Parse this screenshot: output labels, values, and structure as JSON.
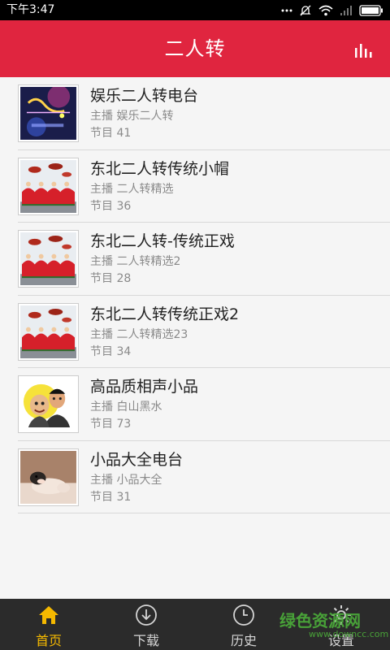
{
  "status_bar": {
    "time": "下午3:47"
  },
  "app_bar": {
    "title": "二人转"
  },
  "stations": [
    {
      "title": "娱乐二人转电台",
      "host": "主播 娱乐二人转",
      "count": "节目 41"
    },
    {
      "title": "东北二人转传统小帽",
      "host": "主播 二人转精选",
      "count": "节目 36"
    },
    {
      "title": "东北二人转-传统正戏",
      "host": "主播 二人转精选2",
      "count": "节目 28"
    },
    {
      "title": "东北二人转传统正戏2",
      "host": "主播 二人转精选23",
      "count": "节目 34"
    },
    {
      "title": "高品质相声小品",
      "host": "主播 白山黑水",
      "count": "节目 73"
    },
    {
      "title": "小品大全电台",
      "host": "主播 小品大全",
      "count": "节目 31"
    }
  ],
  "tabs": [
    {
      "label": "首页",
      "icon": "home-icon",
      "active": true
    },
    {
      "label": "下载",
      "icon": "download-icon",
      "active": false
    },
    {
      "label": "历史",
      "icon": "clock-icon",
      "active": false
    },
    {
      "label": "设置",
      "icon": "gear-icon",
      "active": false
    }
  ],
  "watermark": {
    "text": "绿色资源网",
    "sub": "www.downcc.com"
  },
  "colors": {
    "accent": "#e0253f",
    "tab_active": "#f5b900",
    "tab_bg": "#2b2b2b"
  }
}
